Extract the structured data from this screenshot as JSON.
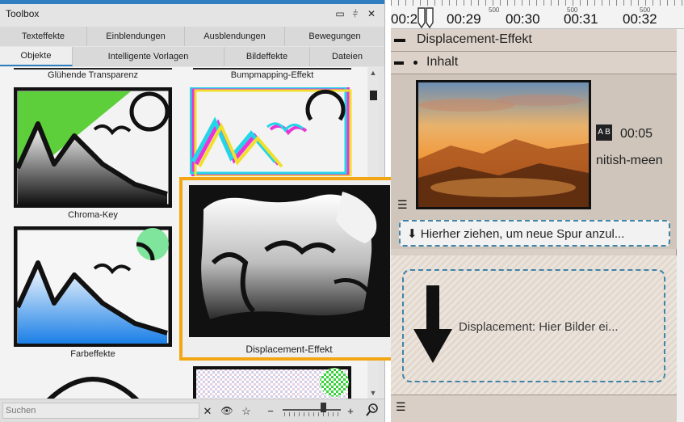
{
  "toolbox": {
    "title": "Toolbox",
    "controls": {
      "maximize": "▭",
      "pin": "⫩",
      "close": "✕"
    },
    "tabs_row1": [
      "Texteffekte",
      "Einblendungen",
      "Ausblendungen",
      "Bewegungen"
    ],
    "tabs_row2": [
      "Objekte",
      "Intelligente Vorlagen",
      "Bildeffekte",
      "Dateien"
    ],
    "active_tab": "Objekte",
    "items": [
      {
        "label": "Glühende Transparenz"
      },
      {
        "label": "Bumpmapping-Effekt"
      },
      {
        "label": "Chroma-Key"
      },
      {
        "label": "Farbeffekte"
      }
    ],
    "dragged_item": {
      "label": "Displacement-Effekt"
    },
    "search": {
      "placeholder": "Suchen",
      "value": ""
    },
    "bottom_buttons": {
      "clear": "✕",
      "eye": "👁",
      "favorite": "☆",
      "zoom_out": "−",
      "zoom_in": "+"
    },
    "zoom_level": 0.7
  },
  "timeline": {
    "ruler_minor_label": "500",
    "times": [
      "00:28",
      "00:29",
      "00:30",
      "00:31",
      "00:32"
    ],
    "track_title": "Displacement-Effekt",
    "subtrack_title": "Inhalt",
    "clip": {
      "duration": "00:05",
      "name": "nitish-meen",
      "badge": "A B"
    },
    "dropzone_text": "⬇ Hierher ziehen, um neue Spur anzul...",
    "effect_drop_text": "Displacement: Hier Bilder ei..."
  },
  "colors": {
    "accent_orange": "#f3a614",
    "accent_blue": "#2f7fc0",
    "dash_blue": "#3f84a8"
  }
}
